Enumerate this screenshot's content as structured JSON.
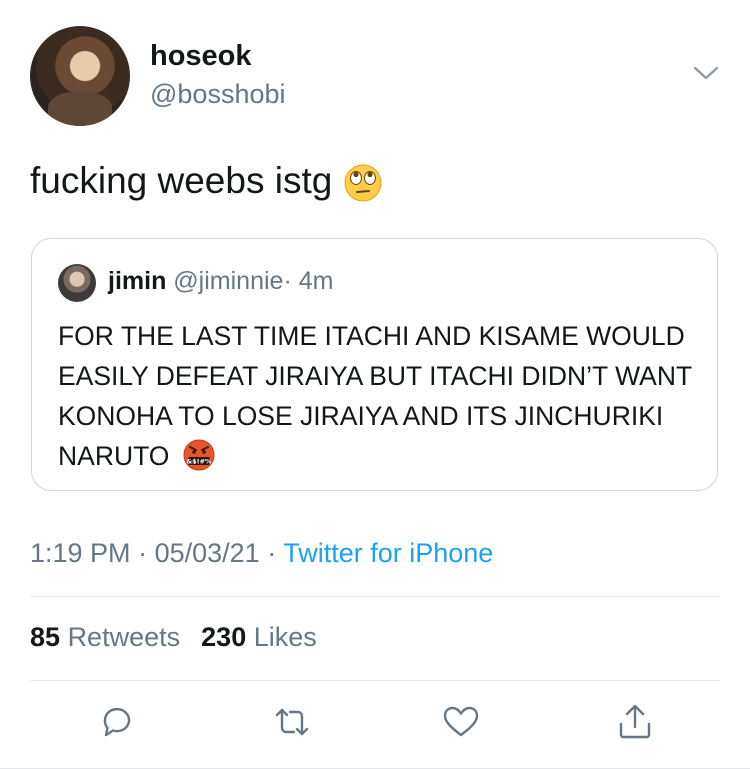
{
  "author": {
    "display_name": "hoseok",
    "handle": "@bosshobi"
  },
  "tweet": {
    "text": "fucking weebs istg",
    "emoji": "face-with-rolling-eyes"
  },
  "quoted_tweet": {
    "display_name": "jimin",
    "handle": "@jiminnie",
    "separator": "·",
    "time": "4m",
    "text": "FOR THE LAST TIME ITACHI AND KISAME WOULD EASILY DEFEAT JIRAIYA BUT ITACHI DIDN’T WANT KONOHA TO LOSE JIRAIYA AND ITS JINCHURIKI NARUTO",
    "emoji": "face-with-symbols-on-mouth",
    "emoji_text": "&$!#%"
  },
  "meta": {
    "time": "1:19 PM",
    "separator": "·",
    "date": "05/03/21",
    "separator2": "·",
    "source": "Twitter for iPhone"
  },
  "stats": {
    "retweets_count": "85",
    "retweets_label": "Retweets",
    "likes_count": "230",
    "likes_label": "Likes"
  },
  "actions": [
    "reply-icon",
    "retweet-icon",
    "like-icon",
    "share-icon"
  ],
  "colors": {
    "text": "#14171a",
    "secondary": "#657786",
    "link": "#1da1f2",
    "border": "#ccd6dd"
  }
}
